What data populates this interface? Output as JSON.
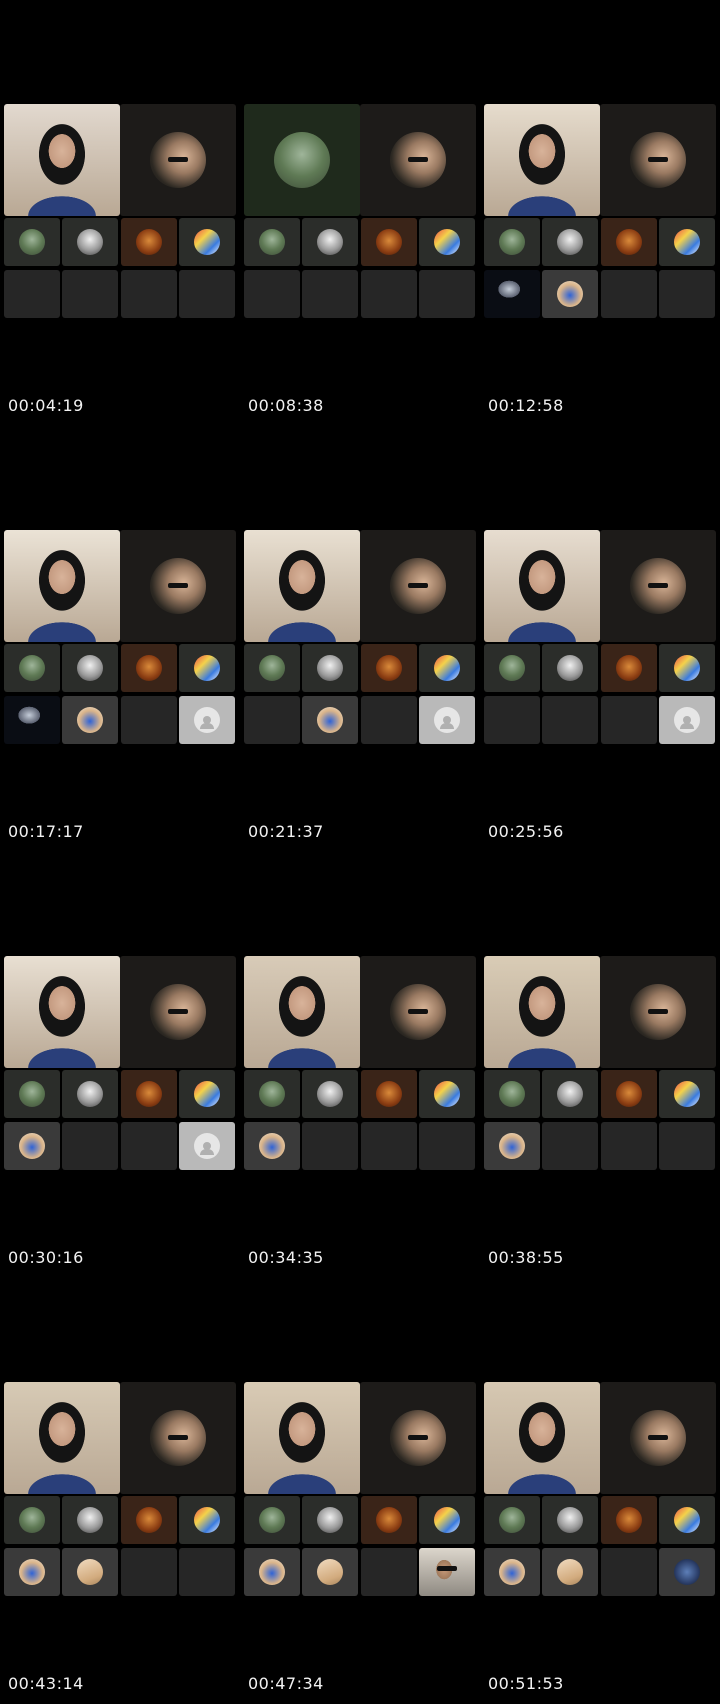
{
  "frames": [
    {
      "timestamp": "00:04:19",
      "row2": [
        "empty",
        "empty",
        "empty",
        "empty"
      ],
      "main_bg": "#e2d9cf"
    },
    {
      "timestamp": "00:08:38",
      "row2": [
        "empty",
        "empty",
        "empty",
        "empty"
      ],
      "main_bg": "#1f2a1c"
    },
    {
      "timestamp": "00:12:58",
      "row2": [
        "dark-photo",
        "balloon",
        "empty",
        "empty"
      ],
      "main_bg": "#e6dccd"
    },
    {
      "timestamp": "00:17:17",
      "row2": [
        "dark-photo",
        "balloon",
        "empty",
        "placeholder"
      ],
      "main_bg": "#ebe3d6"
    },
    {
      "timestamp": "00:21:37",
      "row2": [
        "empty",
        "balloon",
        "empty",
        "placeholder"
      ],
      "main_bg": "#e9e0d2"
    },
    {
      "timestamp": "00:25:56",
      "row2": [
        "empty",
        "empty",
        "empty",
        "placeholder"
      ],
      "main_bg": "#e7ddd0"
    },
    {
      "timestamp": "00:30:16",
      "row2": [
        "balloon",
        "empty",
        "empty",
        "placeholder"
      ],
      "main_bg": "#e8dfd2"
    },
    {
      "timestamp": "00:34:35",
      "row2": [
        "balloon",
        "empty",
        "empty",
        "empty"
      ],
      "main_bg": "#d8cbb8"
    },
    {
      "timestamp": "00:38:55",
      "row2": [
        "balloon",
        "empty",
        "empty",
        "empty"
      ],
      "main_bg": "#d9ccb6"
    },
    {
      "timestamp": "00:43:14",
      "row2": [
        "balloon",
        "bag",
        "empty",
        "empty"
      ],
      "main_bg": "#d7cab5"
    },
    {
      "timestamp": "00:47:34",
      "row2": [
        "balloon",
        "bag",
        "empty",
        "car-selfie"
      ],
      "main_bg": "#d9cbb5"
    },
    {
      "timestamp": "00:51:53",
      "row2": [
        "balloon",
        "bag",
        "empty",
        "globe"
      ],
      "main_bg": "#d6c8b2"
    }
  ],
  "row1_avatars": [
    "landscape-avatar",
    "portrait-avatar",
    "orange-avatar",
    "colorful-avatar"
  ],
  "colors": {
    "background": "#000000",
    "tile": "#2a2a2a",
    "host_tile": "#1d1b19",
    "timestamp_text": "#f2f2f2"
  }
}
